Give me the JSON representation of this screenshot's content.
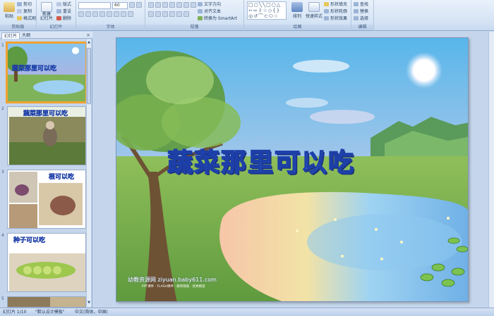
{
  "ribbon": {
    "clipboard": {
      "label": "剪贴板",
      "paste": "粘贴",
      "cut": "剪切",
      "copy": "复制",
      "format_painter": "格式刷"
    },
    "slides": {
      "label": "幻灯片",
      "new_slide": "新建\n幻灯片",
      "layout": "版式",
      "reset": "重设",
      "delete": "删除"
    },
    "font": {
      "label": "字体",
      "font_name": "",
      "font_size": "60"
    },
    "paragraph": {
      "label": "段落",
      "text_direction": "文字方向",
      "align_text": "对齐文本",
      "smartart": "转换为 SmartArt"
    },
    "drawing": {
      "label": "绘图",
      "arrange": "排列",
      "quick_styles": "快速样式",
      "shape_fill": "形状填充",
      "shape_outline": "形状轮廓",
      "shape_effects": "形状效果"
    },
    "editing": {
      "label": "编辑",
      "find": "查找",
      "replace": "替换",
      "select": "选择"
    }
  },
  "left_pane": {
    "tab_slides": "幻灯片",
    "tab_outline": "大纲",
    "close": "×",
    "thumbnails": [
      {
        "number": "1",
        "caption": "蔬菜那里可以吃"
      },
      {
        "number": "2",
        "caption": "蔬菜那里可以吃"
      },
      {
        "number": "3",
        "caption": "根可以吃"
      },
      {
        "number": "4",
        "caption": "种子可以吃"
      },
      {
        "number": "5",
        "caption": ""
      }
    ]
  },
  "slide": {
    "title": "蔬菜那里可以吃",
    "watermark": "幼教资源网 ziyuan.baby611.com",
    "watermark_sub": "PPT课件 · FLASH课件 · 教师随笔 · 优秀教案"
  },
  "status_bar": {
    "slide_info": "幻灯片 1/10",
    "theme": "\"默认设计模板\"",
    "language": "中文(简体，中国)"
  },
  "colors": {
    "ribbon_bg": "#dbe7f6",
    "selection": "#f0a232",
    "title_fill": "#5aa6ef",
    "title_stroke": "#1d3fa8"
  }
}
